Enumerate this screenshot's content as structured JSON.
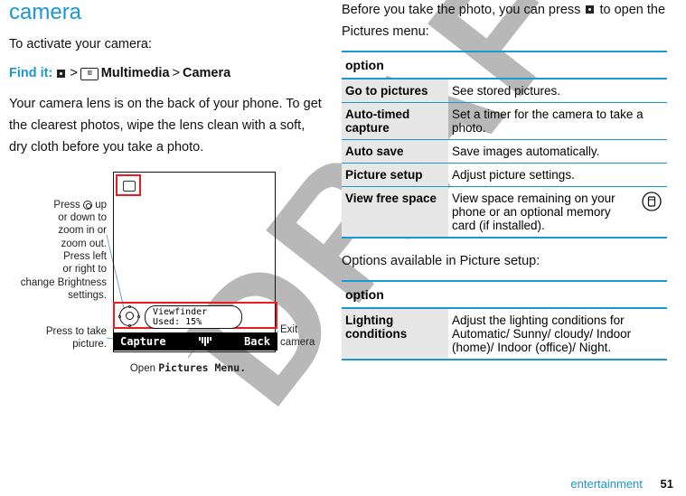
{
  "left": {
    "heading": "camera",
    "intro": "To activate your camera:",
    "findit_label": "Find it:",
    "gt": ">",
    "multimedia": "Multimedia",
    "camera": "Camera",
    "lens_para": "Your camera lens is on the back of your phone. To get the clearest photos, wipe the lens clean with a soft, dry cloth before you take a photo.",
    "diagram": {
      "vf_line1": "Viewfinder",
      "vf_line2": "Used: 15%",
      "soft_left": "Capture",
      "soft_right": "Back",
      "callout_zoom": "Press      up or down to zoom in or zoom out. Press left or right to change Brightness settings.",
      "callout_press": "Press to take picture.",
      "callout_open_pre": "Open ",
      "callout_open_mono": "Pictures Menu.",
      "callout_exit": "Exit camera"
    }
  },
  "right": {
    "intro_pre": "Before you take the photo, you can press ",
    "intro_post": " to open the Pictures menu:",
    "table1_header": "option",
    "table1": [
      {
        "opt": "Go to pictures",
        "desc": "See stored pictures."
      },
      {
        "opt": "Auto-timed capture",
        "desc": "Set a timer for the camera to take a photo."
      },
      {
        "opt": "Auto save",
        "desc": "Save images automatically."
      },
      {
        "opt": "Picture setup",
        "desc": "Adjust picture settings."
      },
      {
        "opt": "View free space",
        "desc": "View space remaining on your phone or an optional memory card (if installed)."
      }
    ],
    "mid_text": "Options available in Picture setup:",
    "table2_header": "option",
    "table2": [
      {
        "opt": "Lighting conditions",
        "desc": "Adjust the lighting conditions for Automatic/ Sunny/ cloudy/ Indoor (home)/ Indoor (office)/ Night."
      }
    ]
  },
  "footer": {
    "section": "entertainment",
    "page": "51"
  }
}
